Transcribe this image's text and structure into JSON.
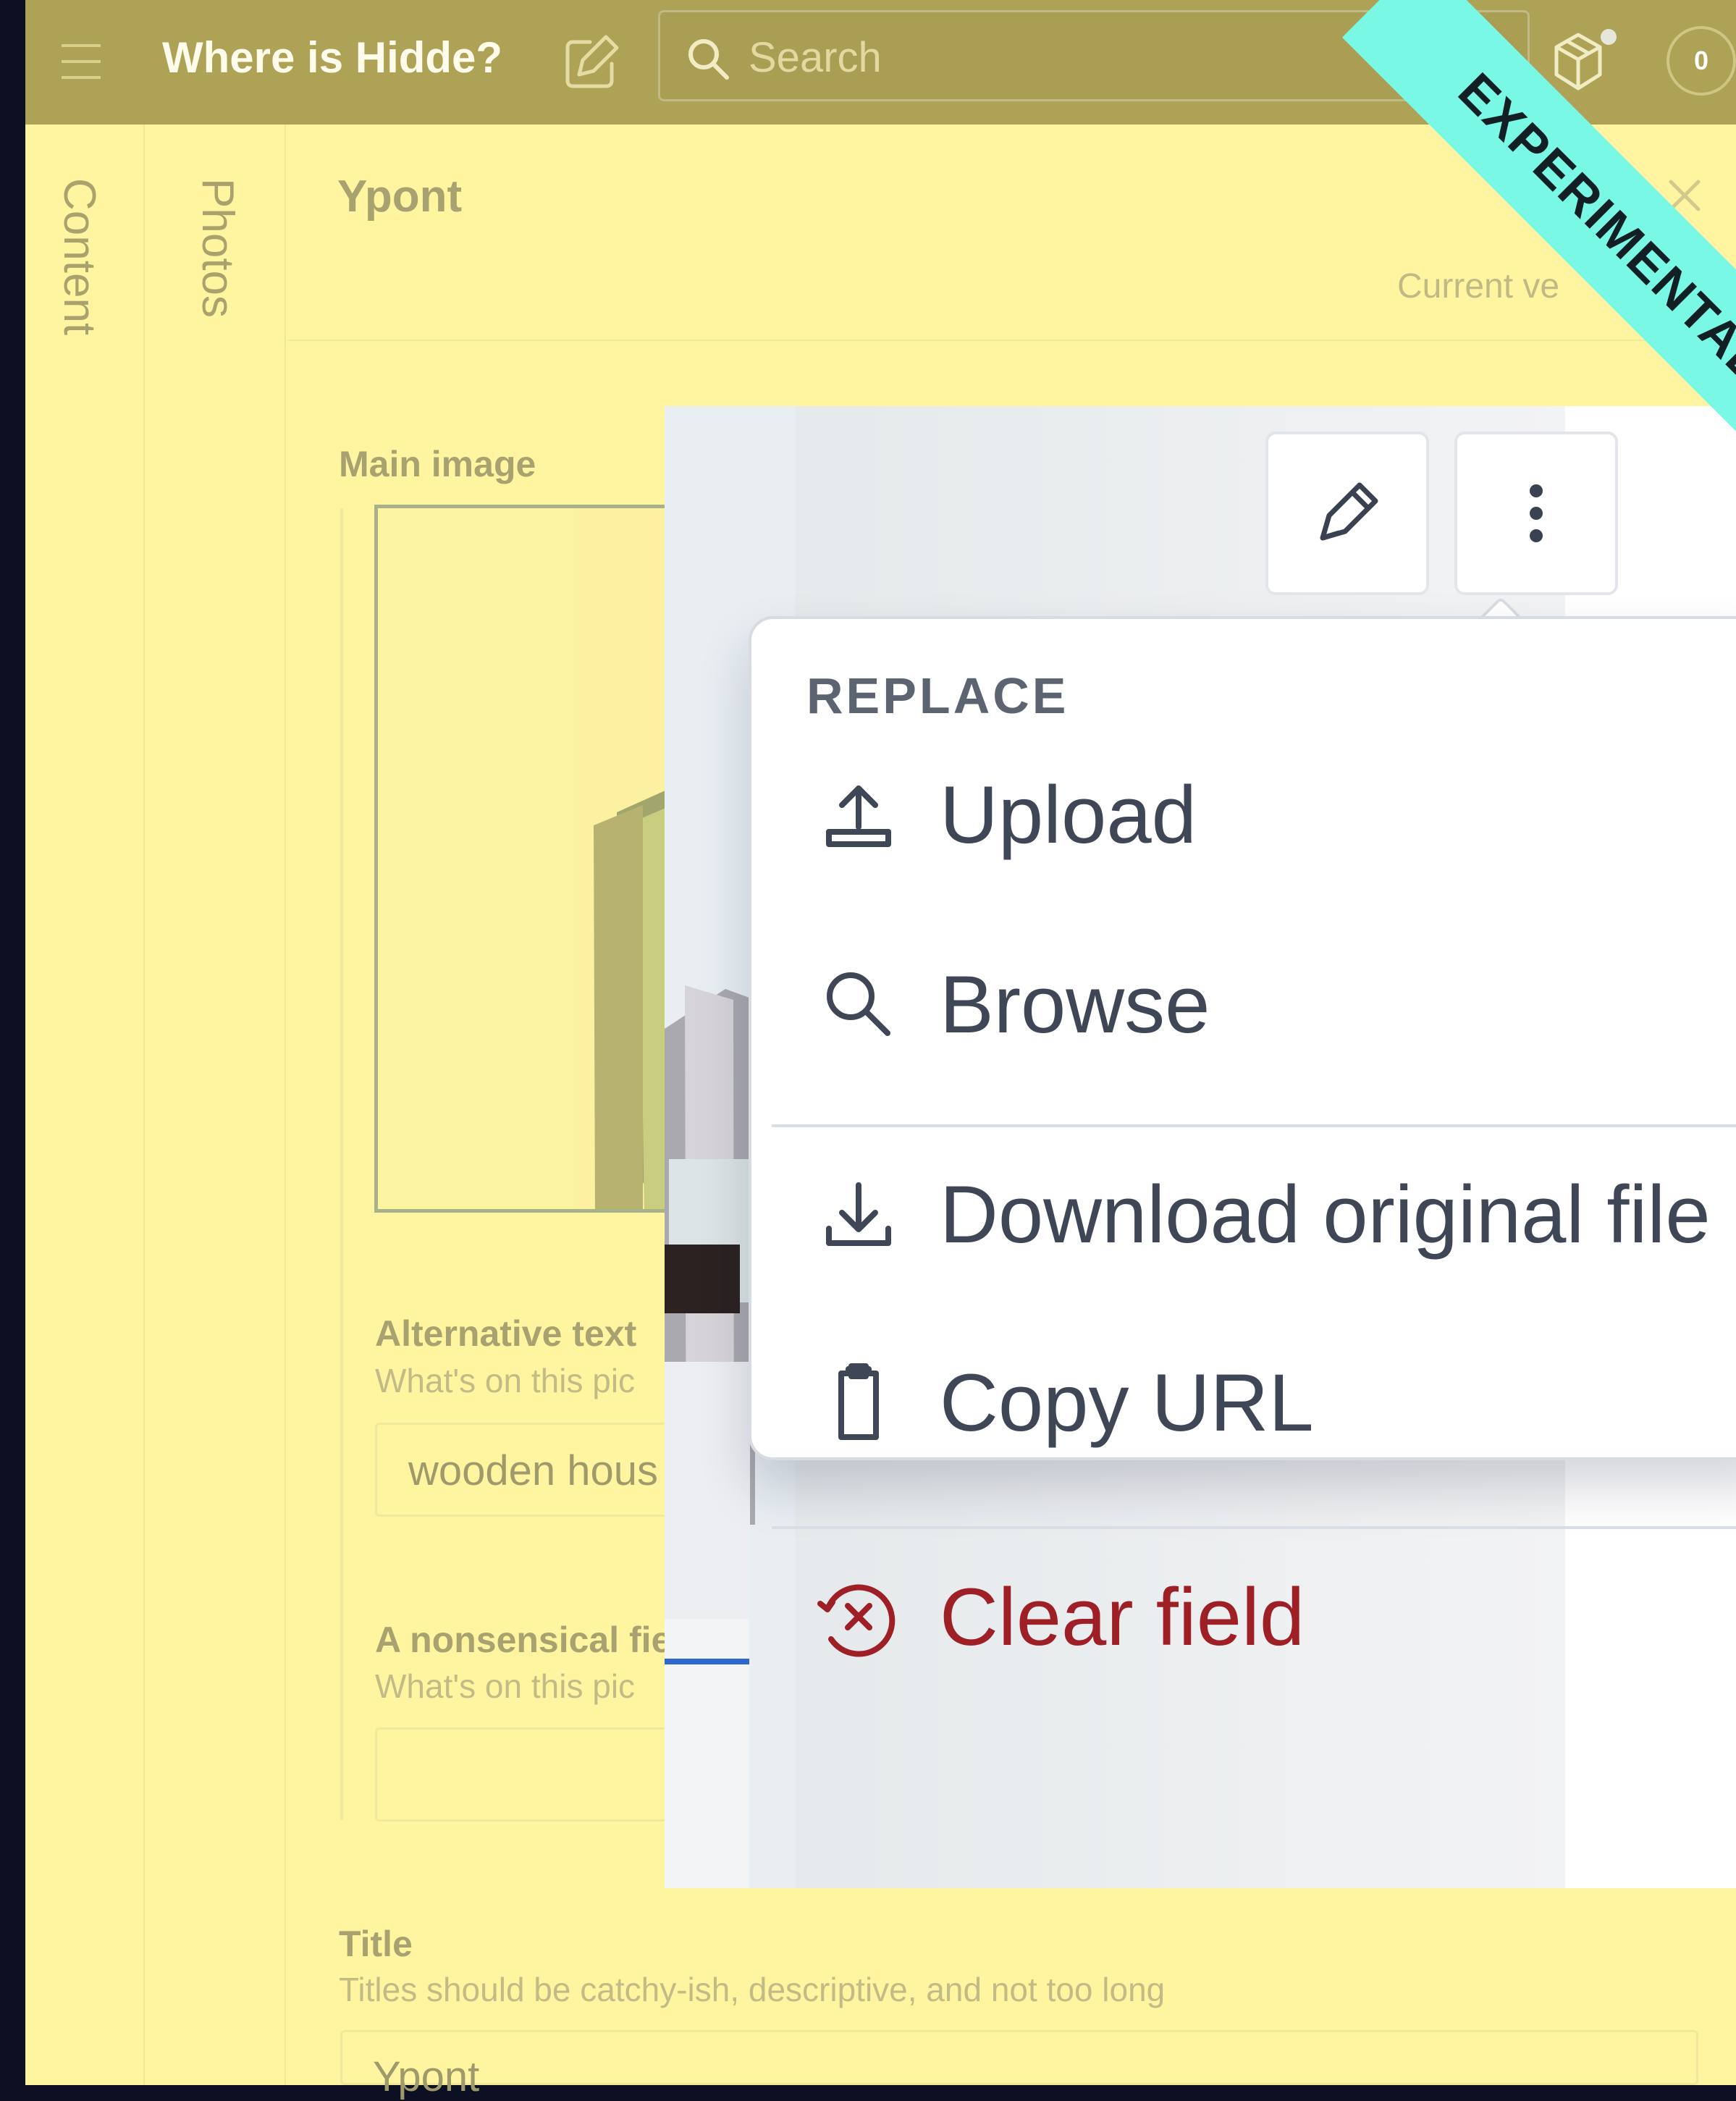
{
  "app": {
    "title": "Where is Hidde?",
    "status_count": "0",
    "ribbon_label": "EXPERIMENTAL"
  },
  "search": {
    "placeholder": "Search"
  },
  "sidebar": {
    "tabs": [
      {
        "label": "Content"
      },
      {
        "label": "Photos"
      }
    ]
  },
  "document": {
    "title": "Ypont",
    "current_version": "Current ve"
  },
  "fields": {
    "main_image_label": "Main image",
    "alt_text_label": "Alternative text",
    "alt_text_description": "What's on this pic",
    "alt_text_value": "wooden hous",
    "nonsense_label": "A nonsensical fie",
    "nonsense_description": "What's on this pic",
    "title_label": "Title",
    "title_description": "Titles should be catchy-ish, descriptive, and not too long",
    "title_value": "Ypont"
  },
  "image_menu": {
    "section_heading": "REPLACE",
    "items": [
      {
        "label": "Upload",
        "icon": "upload-icon"
      },
      {
        "label": "Browse",
        "icon": "search-icon"
      },
      {
        "label": "Download original file",
        "icon": "download-icon"
      },
      {
        "label": "Copy URL",
        "icon": "clipboard-icon"
      },
      {
        "label": "Clear field",
        "icon": "clear-field-icon"
      }
    ]
  },
  "colors": {
    "topbar": "#ADA256",
    "background": "#FFF5A0",
    "ribbon": "#7AF8E6",
    "danger": "#9E1F25"
  }
}
